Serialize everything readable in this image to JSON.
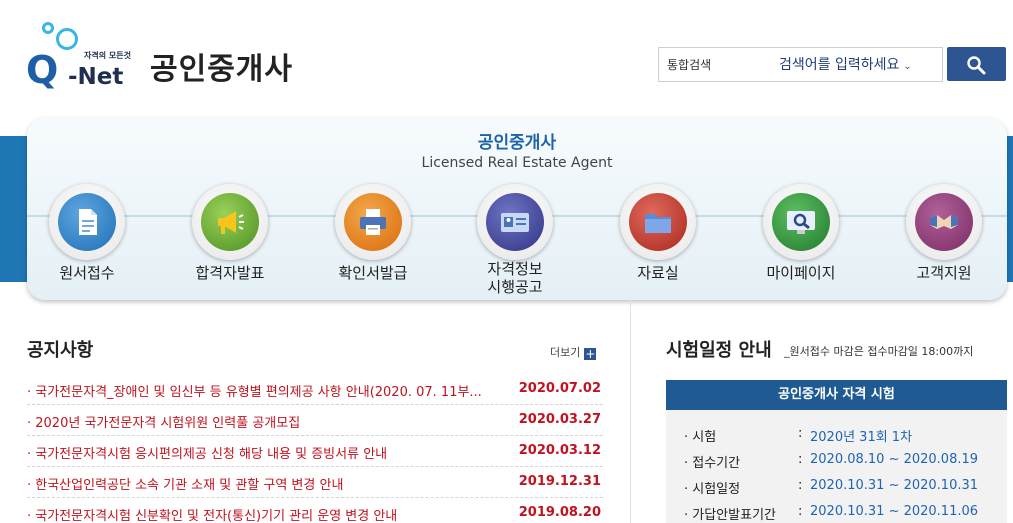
{
  "header": {
    "logo_tagline": "자격의 모든것",
    "logo_q": "Q",
    "logo_net": "-Net",
    "site_title": "공인중개사",
    "search": {
      "scope": "통합검색",
      "placeholder": "검색어를 입력하세요",
      "button_icon": "search-icon"
    }
  },
  "hero": {
    "title": "공인중개사",
    "subtitle": "Licensed Real Estate Agent",
    "menu": [
      {
        "label": "원서접수",
        "icon": "document-icon",
        "color": "#1e6fb5"
      },
      {
        "label": "합격자발표",
        "icon": "megaphone-icon",
        "color": "#5aa02c"
      },
      {
        "label": "확인서발급",
        "icon": "printer-icon",
        "color": "#e07a12"
      },
      {
        "label_line1": "자격정보",
        "label_line2": "시행공고",
        "icon": "id-card-icon",
        "color": "#3a3f92"
      },
      {
        "label": "자료실",
        "icon": "folder-icon",
        "color": "#c0392b"
      },
      {
        "label": "마이페이지",
        "icon": "monitor-search-icon",
        "color": "#2f8f3a"
      },
      {
        "label": "고객지원",
        "icon": "handshake-icon",
        "color": "#8e3b74"
      }
    ]
  },
  "notices": {
    "title": "공지사항",
    "more_label": "더보기",
    "items": [
      {
        "text": "· 국가전문자격_장애인 및 임신부 등 유형별 편의제공 사항 안내(2020. 07. 11부...",
        "date": "2020.07.02"
      },
      {
        "text": "· 2020년 국가전문자격 시험위원 인력풀 공개모집",
        "date": "2020.03.27"
      },
      {
        "text": "· 국가전문자격시험 응시편의제공 신청 해당 내용 및 증빙서류 안내",
        "date": "2020.03.12"
      },
      {
        "text": "· 한국산업인력공단 소속 기관 소재 및 관할 구역 변경 안내",
        "date": "2019.12.31"
      },
      {
        "text": "· 국가전문자격시험 신분확인 및 전자(통신)기기 관리 운영 변경 안내",
        "date": "2019.08.20"
      }
    ]
  },
  "schedule": {
    "title": "시험일정 안내",
    "note": "_원서접수 마감은 접수마감일 18:00까지",
    "box_title": "공인중개사 자격 시험",
    "rows": [
      {
        "key": "· 시험",
        "value": "2020년 31회 1차"
      },
      {
        "key": "· 접수기간",
        "value": "2020.08.10 ~ 2020.08.19"
      },
      {
        "key": "· 시험일정",
        "value": "2020.10.31 ~ 2020.10.31"
      },
      {
        "key": "· 가답안발표기간",
        "value": "2020.10.31 ~ 2020.11.06"
      }
    ]
  }
}
